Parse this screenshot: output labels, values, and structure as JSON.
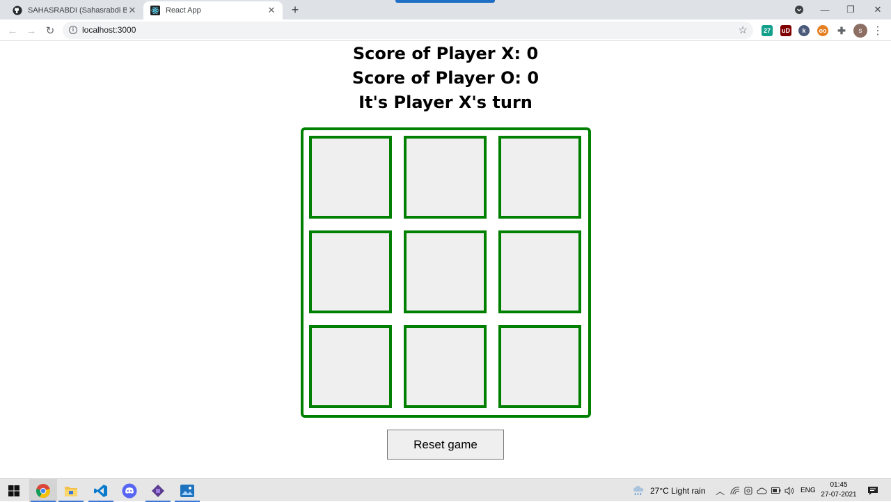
{
  "browser": {
    "tabs": [
      {
        "title": "SAHASRABDI (Sahasrabdi Bhattac",
        "icon": "github-icon",
        "active": false
      },
      {
        "title": "React App",
        "icon": "react-icon",
        "active": true
      }
    ],
    "url": "localhost:3000",
    "profile_initial": "s",
    "extensions": [
      {
        "name": "extension-27-icon",
        "label": "27",
        "color": "#12a08a"
      },
      {
        "name": "ublock-icon",
        "label": "uD",
        "color": "#800000"
      },
      {
        "name": "extension-k-icon",
        "label": "k",
        "color": "#4a5a7a"
      },
      {
        "name": "extension-glasses-icon",
        "label": "oo",
        "color": "#e67e22"
      },
      {
        "name": "extensions-puzzle-icon",
        "label": "",
        "color": "#5f6368"
      }
    ]
  },
  "game": {
    "score_x": "Score of Player X: 0",
    "score_o": "Score of Player O: 0",
    "turn": "It's Player X's turn",
    "cells": [
      "",
      "",
      "",
      "",
      "",
      "",
      "",
      "",
      ""
    ],
    "reset_label": "Reset game",
    "accent_color": "#008000"
  },
  "taskbar": {
    "weather": "27°C  Light rain",
    "language": "ENG",
    "time": "01:45",
    "date": "27-07-2021",
    "apps": [
      "chrome-icon",
      "file-explorer-icon",
      "vscode-icon",
      "discord-icon",
      "app-diamond-icon",
      "photos-icon"
    ]
  }
}
